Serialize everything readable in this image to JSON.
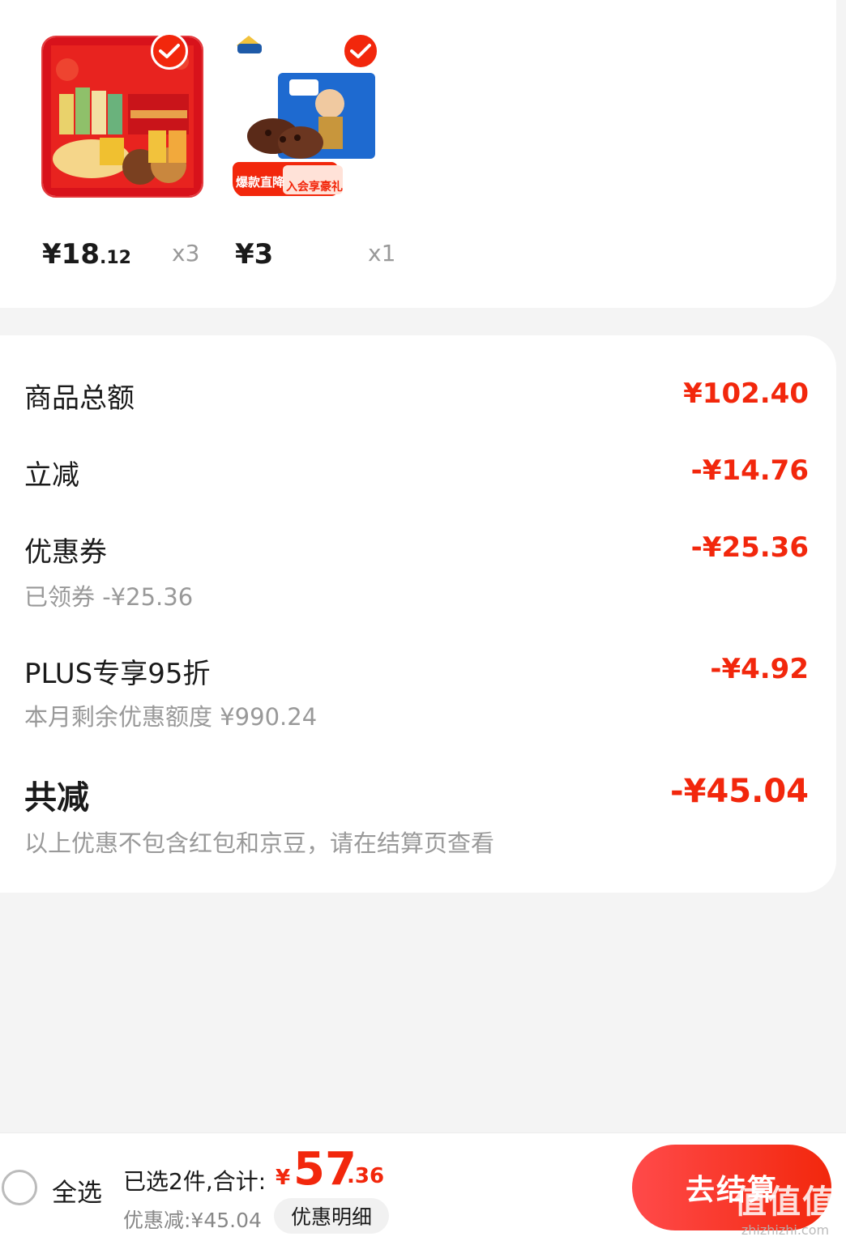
{
  "products": [
    {
      "price_int": "¥18",
      "price_dec": ".12",
      "qty": "x3",
      "checked": true,
      "thumb_icon": "gift-box-product-image"
    },
    {
      "price_int": "¥3",
      "price_dec": "",
      "qty": "x1",
      "checked": true,
      "thumb_icon": "cookie-pack-product-image",
      "badge1": "爆款直降",
      "badge2": "入会享豪礼"
    }
  ],
  "summary": {
    "goods_total_label": "商品总额",
    "goods_total_value": "¥102.40",
    "instant_label": "立减",
    "instant_value": "-¥14.76",
    "coupon_label": "优惠券",
    "coupon_value": "-¥25.36",
    "coupon_sub": "已领券 -¥25.36",
    "plus_label": "PLUS专享95折",
    "plus_value": "-¥4.92",
    "plus_sub": "本月剩余优惠额度 ¥990.24",
    "total_label": "共减",
    "total_value": "-¥45.04",
    "note": "以上优惠不包含红包和京豆，请在结算页查看"
  },
  "bottom_bar": {
    "select_all": "全选",
    "selected_text": "已选2件,合计:",
    "currency": "¥",
    "total_int": "57",
    "total_dec": ".36",
    "discount_text": "优惠减:¥45.04",
    "detail_button": "优惠明细",
    "checkout_button": "去结算"
  },
  "watermark": {
    "big": "值值值",
    "small": "zhizhizhi.com"
  },
  "colors": {
    "accent": "#f2270c",
    "muted": "#999999"
  }
}
